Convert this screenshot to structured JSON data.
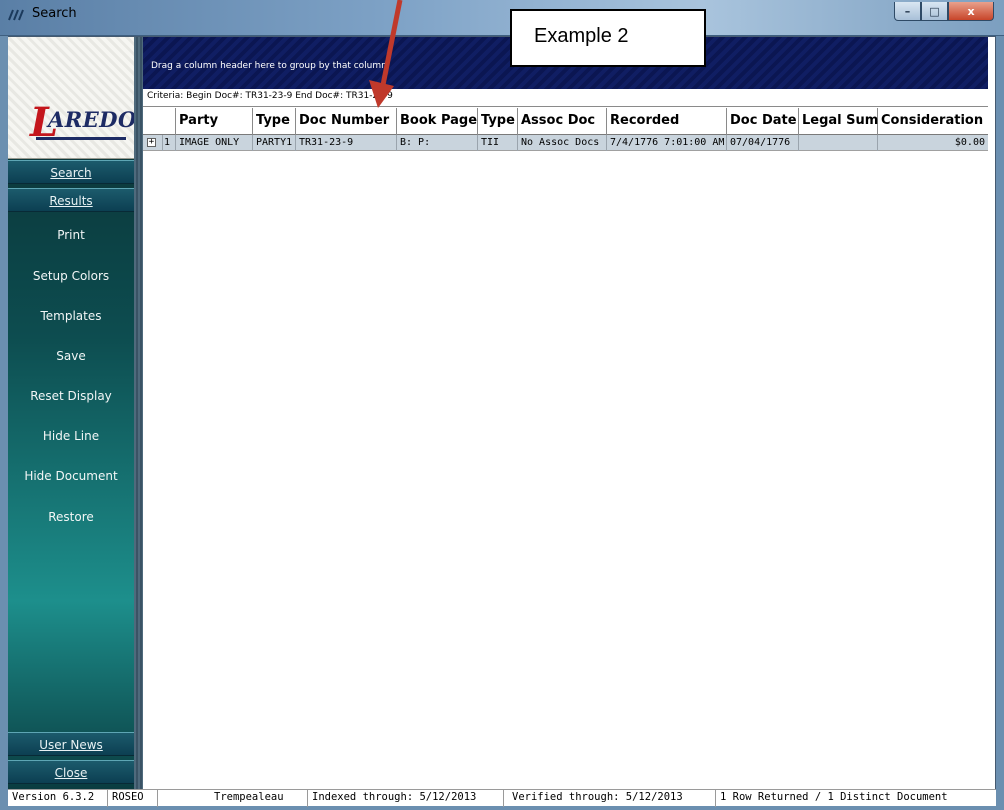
{
  "window": {
    "title": "Search",
    "min_glyph": "–",
    "max_glyph": "□",
    "close_glyph": "x"
  },
  "annotation": {
    "label": "Example 2",
    "arrow_color": "#c0392b"
  },
  "logo": {
    "initial": "L",
    "word": "AREDO"
  },
  "sidebar": {
    "tabs": {
      "search": "Search",
      "results": "Results",
      "user_news": "User News",
      "close": "Close"
    },
    "items": [
      "Print",
      "Setup Colors",
      "Templates",
      "Save",
      "Reset Display",
      "Hide Line",
      "Hide Document",
      "Restore"
    ]
  },
  "group_panel": {
    "hint": "Drag a column header here to group by that column"
  },
  "criteria": {
    "text": "Criteria: Begin Doc#: TR31-23-9 End Doc#: TR31-23-9"
  },
  "grid": {
    "columns": [
      "Party",
      "Type",
      "Doc Number",
      "Book Page",
      "Type",
      "Assoc Doc",
      "Recorded",
      "Doc Date",
      "Legal Sum",
      "Consideration"
    ],
    "rows": [
      {
        "expand": "+",
        "num": "1",
        "cells": [
          "IMAGE ONLY",
          "PARTY1",
          "TR31-23-9",
          "B: P:",
          "TII",
          "No Assoc Docs",
          "7/4/1776 7:01:00 AM",
          "07/04/1776",
          "",
          "$0.00"
        ]
      }
    ]
  },
  "statusbar": {
    "version": "Version 6.3.2",
    "user": "ROSEO",
    "county": "Trempealeau",
    "indexed": "Indexed through: 5/12/2013",
    "verified": "Verified through: 5/12/2013",
    "results": "1 Row Returned / 1 Distinct Document"
  }
}
